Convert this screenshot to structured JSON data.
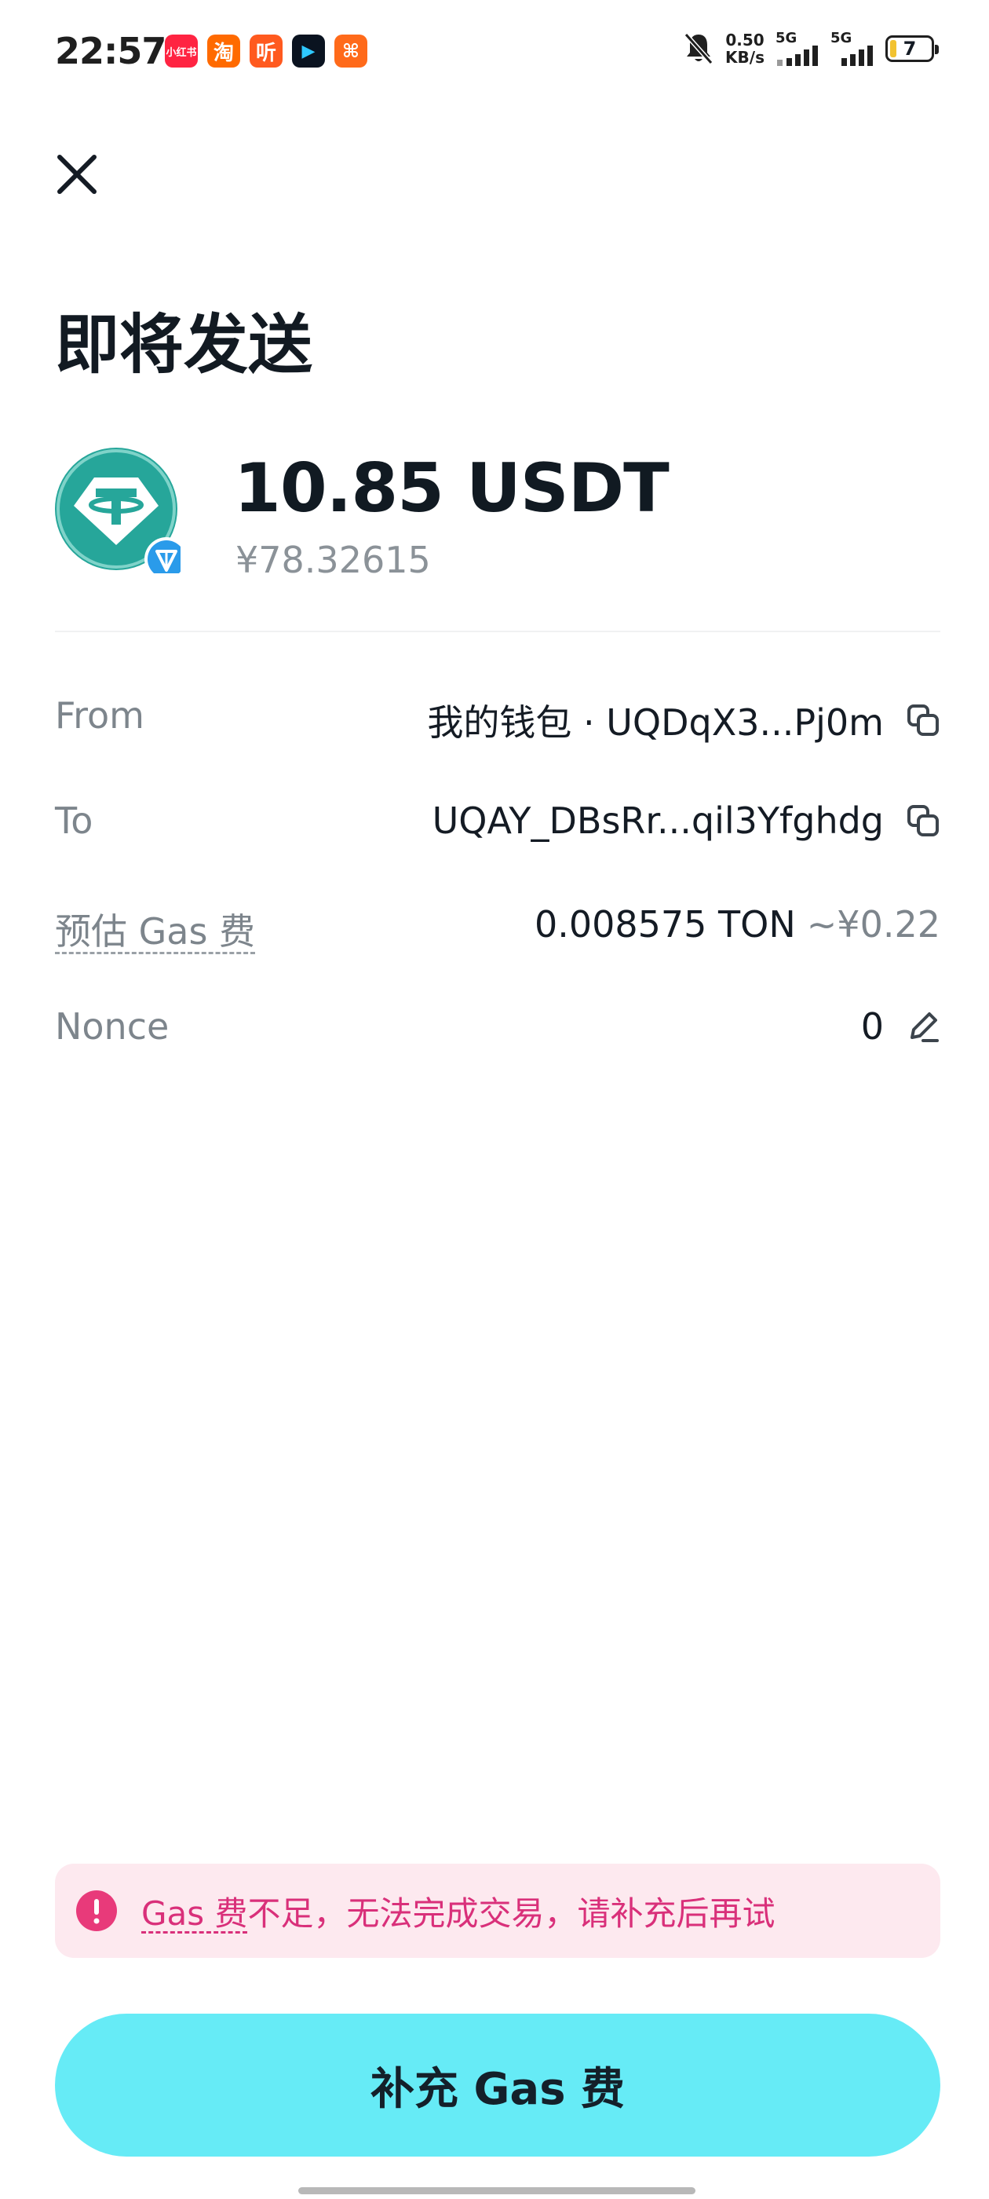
{
  "status_bar": {
    "time": "22:57",
    "net_speed_value": "0.50",
    "net_speed_unit": "KB/s",
    "signal_1_label": "5G",
    "signal_2_label": "5G",
    "battery_level": "7",
    "app_icons": [
      {
        "name": "xiaohongshu-icon",
        "color": "#ff2442",
        "text": "小红书"
      },
      {
        "name": "taobao-icon",
        "color": "#ff6a00",
        "text": "淘"
      },
      {
        "name": "ting-icon",
        "color": "#ff5a1f",
        "text": "听"
      },
      {
        "name": "play-app-icon",
        "color": "#0a1320",
        "text": "▶"
      },
      {
        "name": "orange-app-icon",
        "color": "#ff6a1a",
        "text": "⌘"
      }
    ]
  },
  "page": {
    "title": "即将发送",
    "close_icon": "close-icon"
  },
  "token": {
    "amount": "10.85 USDT",
    "fiat_value": "¥78.32615",
    "token_logo": "tether-icon",
    "network_badge": "ton-icon",
    "token_color": "#26a69a",
    "badge_color": "#2a9bea"
  },
  "details": {
    "from_label": "From",
    "from_value": "我的钱包 · UQDqX3...Pj0m",
    "to_label": "To",
    "to_value": "UQAY_DBsRr...qil3Yfghdg",
    "gas_label": "预估 Gas 费",
    "gas_value": "0.008575 TON",
    "gas_fiat": "~¥0.22",
    "nonce_label": "Nonce",
    "nonce_value": "0"
  },
  "warning": {
    "gas_link": "Gas 费",
    "text": "不足，无法完成交易，请补充后再试",
    "color": "#d9307a",
    "background": "#fde9ef"
  },
  "action": {
    "button_label": "补充 Gas 费",
    "button_color": "#66ebf6"
  }
}
